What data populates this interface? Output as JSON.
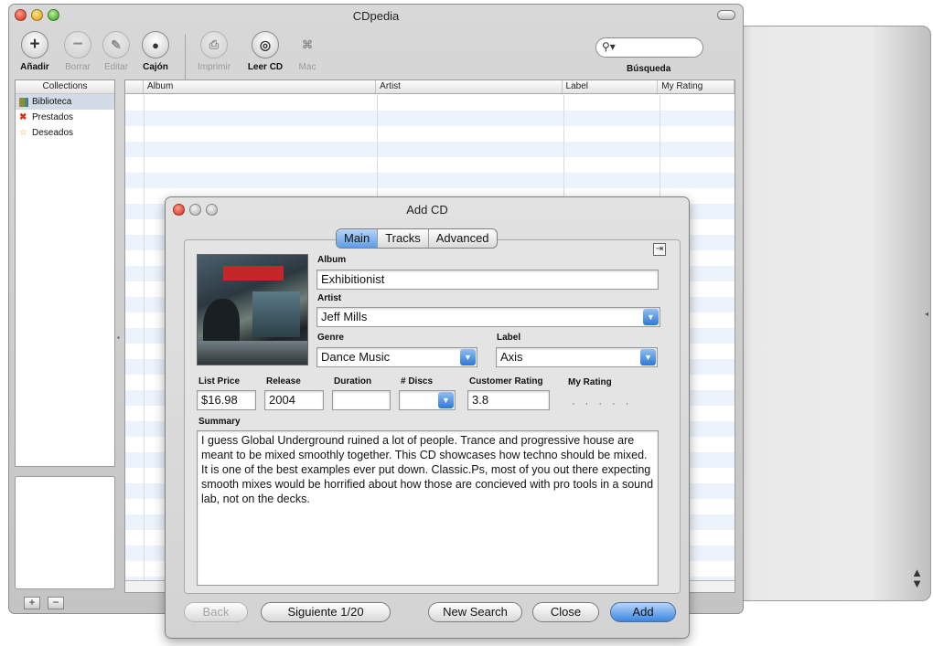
{
  "window": {
    "title": "CDpedia"
  },
  "toolbar": {
    "add": "Añadir",
    "delete": "Borrar",
    "edit": "Editar",
    "drawer": "Cajón",
    "print": "Imprimir",
    "read_cd": "Leer CD",
    "mac": "Mac",
    "search_label": "Búsqueda",
    "search_value": ""
  },
  "sidebar": {
    "header": "Collections",
    "items": [
      {
        "label": "Biblioteca",
        "icon": "library-icon"
      },
      {
        "label": "Prestados",
        "icon": "borrowed-icon"
      },
      {
        "label": "Deseados",
        "icon": "star-icon"
      }
    ]
  },
  "table": {
    "columns": [
      "Album",
      "Artist",
      "Label",
      "My Rating"
    ]
  },
  "sheet": {
    "title": "Add CD",
    "tabs": [
      "Main",
      "Tracks",
      "Advanced"
    ],
    "active_tab": "Main",
    "fields": {
      "album_label": "Album",
      "album": "Exhibitionist",
      "artist_label": "Artist",
      "artist": "Jeff Mills",
      "genre_label": "Genre",
      "genre": "Dance Music",
      "label_label": "Label",
      "label": "Axis",
      "list_price_label": "List Price",
      "list_price": "$16.98",
      "release_label": "Release",
      "release": "2004",
      "duration_label": "Duration",
      "duration": "",
      "discs_label": "# Discs",
      "discs": "",
      "customer_rating_label": "Customer Rating",
      "customer_rating": "3.8",
      "my_rating_label": "My Rating",
      "my_rating": 0,
      "summary_label": "Summary",
      "summary": "I guess Global Underground ruined a lot of people. Trance and progressive house are meant to be mixed smoothly together. This CD showcases how techno should be mixed. It is one of the best examples ever put down. Classic.Ps, most of you out there expecting smooth mixes would be horrified about how those are concieved with pro tools in a sound lab, not on the decks."
    },
    "buttons": {
      "back": "Back",
      "next": "Siguiente 1/20",
      "new_search": "New Search",
      "close": "Close",
      "add": "Add"
    }
  },
  "colors": {
    "accent": "#3b86e2",
    "stripe": "#edf3fd"
  }
}
